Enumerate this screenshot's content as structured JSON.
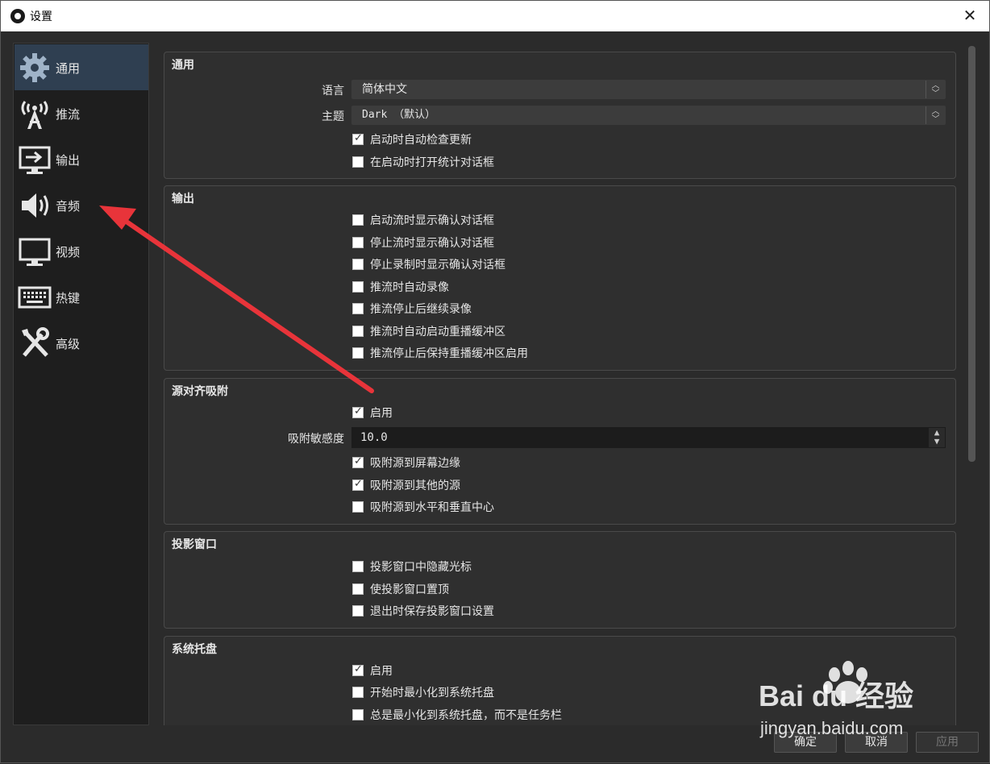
{
  "window": {
    "title": "设置"
  },
  "sidebar": {
    "items": [
      {
        "label": "通用",
        "icon": "gear-icon"
      },
      {
        "label": "推流",
        "icon": "antenna-icon"
      },
      {
        "label": "输出",
        "icon": "output-monitor-icon"
      },
      {
        "label": "音频",
        "icon": "speaker-icon"
      },
      {
        "label": "视频",
        "icon": "monitor-icon"
      },
      {
        "label": "热键",
        "icon": "keyboard-icon"
      },
      {
        "label": "高级",
        "icon": "tools-icon"
      }
    ]
  },
  "general": {
    "title": "通用",
    "language_label": "语言",
    "language_value": "简体中文",
    "theme_label": "主题",
    "theme_value": "Dark （默认）",
    "check_updates": {
      "label": "启动时自动检查更新",
      "checked": true
    },
    "open_stats": {
      "label": "在启动时打开统计对话框",
      "checked": false
    }
  },
  "output": {
    "title": "输出",
    "options": [
      {
        "label": "启动流时显示确认对话框",
        "checked": false
      },
      {
        "label": "停止流时显示确认对话框",
        "checked": false
      },
      {
        "label": "停止录制时显示确认对话框",
        "checked": false
      },
      {
        "label": "推流时自动录像",
        "checked": false
      },
      {
        "label": "推流停止后继续录像",
        "checked": false
      },
      {
        "label": "推流时自动启动重播缓冲区",
        "checked": false
      },
      {
        "label": "推流停止后保持重播缓冲区启用",
        "checked": false
      }
    ]
  },
  "snapping": {
    "title": "源对齐吸附",
    "enable": {
      "label": "启用",
      "checked": true
    },
    "sensitivity_label": "吸附敏感度",
    "sensitivity_value": "10.0",
    "options": [
      {
        "label": "吸附源到屏幕边缘",
        "checked": true
      },
      {
        "label": "吸附源到其他的源",
        "checked": true
      },
      {
        "label": "吸附源到水平和垂直中心",
        "checked": false
      }
    ]
  },
  "projectors": {
    "title": "投影窗口",
    "options": [
      {
        "label": "投影窗口中隐藏光标",
        "checked": false
      },
      {
        "label": "使投影窗口置顶",
        "checked": false
      },
      {
        "label": "退出时保存投影窗口设置",
        "checked": false
      }
    ]
  },
  "tray": {
    "title": "系统托盘",
    "options": [
      {
        "label": "启用",
        "checked": true
      },
      {
        "label": "开始时最小化到系统托盘",
        "checked": false
      },
      {
        "label": "总是最小化到系统托盘，而不是任务栏",
        "checked": false
      }
    ]
  },
  "buttons": {
    "ok": "确定",
    "cancel": "取消",
    "apply": "应用"
  },
  "watermark": {
    "logo": "Bai du 经验",
    "url": "jingyan.baidu.com"
  },
  "colors": {
    "accent_active": "#2f3f51",
    "annotation_arrow": "#e8343a"
  }
}
